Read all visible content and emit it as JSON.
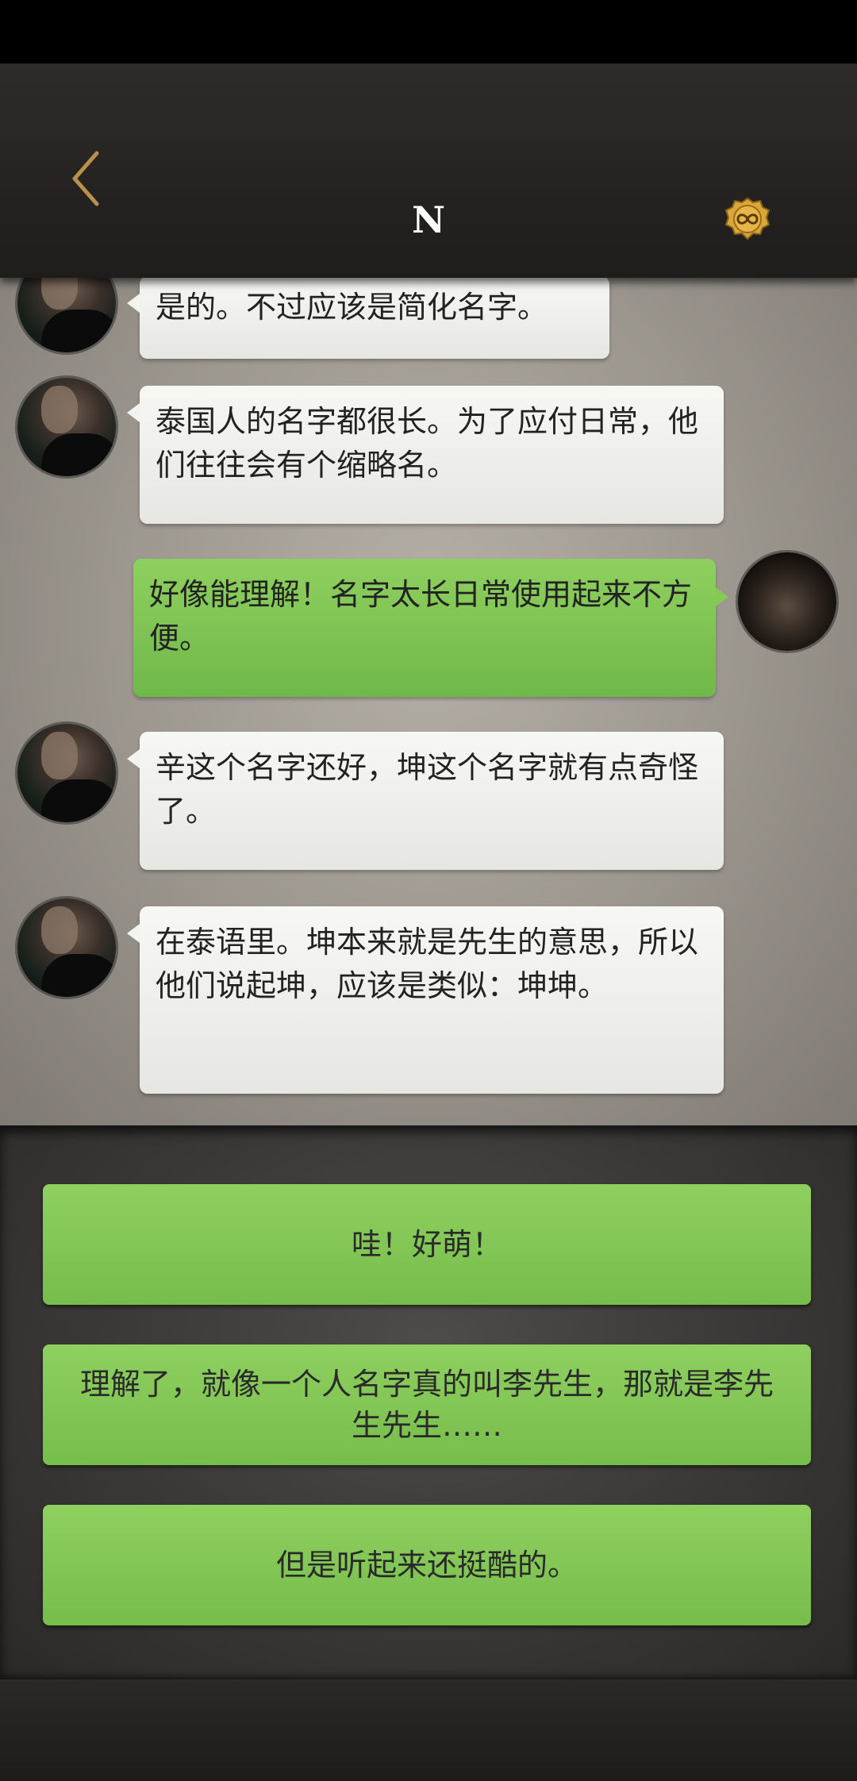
{
  "header": {
    "title": "N"
  },
  "colors": {
    "accent_green": "#7cc452",
    "coin_gold": "#d9a63a",
    "back_arrow": "#b9914a"
  },
  "icons": {
    "back": "chevron-left-icon",
    "coin": "infinity-coin-icon"
  },
  "messages": [
    {
      "side": "left",
      "text": "是的。不过应该是简化名字。"
    },
    {
      "side": "left",
      "text": "泰国人的名字都很长。为了应付日常，他们往往会有个缩略名。"
    },
    {
      "side": "right",
      "text": "好像能理解！名字太长日常使用起来不方便。"
    },
    {
      "side": "left",
      "text": "辛这个名字还好，坤这个名字就有点奇怪了。"
    },
    {
      "side": "left",
      "text": "在泰语里。坤本来就是先生的意思，所以他们说起坤，应该是类似：坤坤。"
    }
  ],
  "options": [
    {
      "label": "哇！好萌！"
    },
    {
      "label": "理解了，就像一个人名字真的叫李先生，那就是李先生先生……"
    },
    {
      "label": "但是听起来还挺酷的。"
    }
  ]
}
